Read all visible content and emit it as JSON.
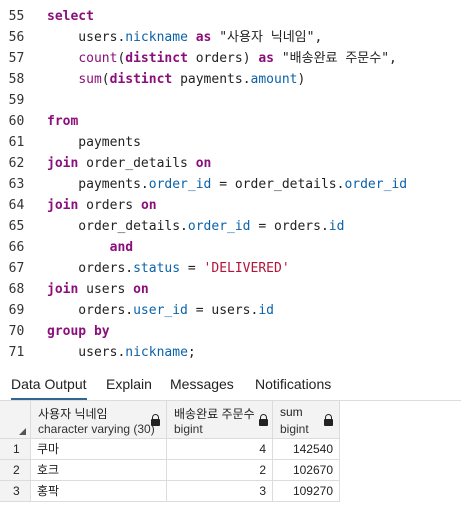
{
  "editor": {
    "lines": [
      {
        "n": "55",
        "tokens": [
          {
            "t": "select",
            "c": "kw"
          }
        ]
      },
      {
        "n": "56",
        "tokens": [
          {
            "t": "    users.",
            "c": "plain"
          },
          {
            "t": "nickname",
            "c": "prop"
          },
          {
            "t": " ",
            "c": "plain"
          },
          {
            "t": "as",
            "c": "kw"
          },
          {
            "t": " \"사용자 닉네임\",",
            "c": "plain"
          }
        ]
      },
      {
        "n": "57",
        "tokens": [
          {
            "t": "    ",
            "c": "plain"
          },
          {
            "t": "count",
            "c": "fn"
          },
          {
            "t": "(",
            "c": "plain"
          },
          {
            "t": "distinct",
            "c": "kw"
          },
          {
            "t": " orders) ",
            "c": "plain"
          },
          {
            "t": "as",
            "c": "kw"
          },
          {
            "t": " \"배송완료 주문수\",",
            "c": "plain"
          }
        ]
      },
      {
        "n": "58",
        "tokens": [
          {
            "t": "    ",
            "c": "plain"
          },
          {
            "t": "sum",
            "c": "fn"
          },
          {
            "t": "(",
            "c": "plain"
          },
          {
            "t": "distinct",
            "c": "kw"
          },
          {
            "t": " payments.",
            "c": "plain"
          },
          {
            "t": "amount",
            "c": "prop"
          },
          {
            "t": ")",
            "c": "plain"
          }
        ]
      },
      {
        "n": "59",
        "tokens": []
      },
      {
        "n": "60",
        "tokens": [
          {
            "t": "from",
            "c": "kw"
          }
        ]
      },
      {
        "n": "61",
        "tokens": [
          {
            "t": "    payments",
            "c": "plain"
          }
        ]
      },
      {
        "n": "62",
        "tokens": [
          {
            "t": "join",
            "c": "kw"
          },
          {
            "t": " order_details ",
            "c": "plain"
          },
          {
            "t": "on",
            "c": "kw"
          }
        ]
      },
      {
        "n": "63",
        "tokens": [
          {
            "t": "    payments.",
            "c": "plain"
          },
          {
            "t": "order_id",
            "c": "prop"
          },
          {
            "t": " = order_details.",
            "c": "plain"
          },
          {
            "t": "order_id",
            "c": "prop"
          }
        ]
      },
      {
        "n": "64",
        "tokens": [
          {
            "t": "join",
            "c": "kw"
          },
          {
            "t": " orders ",
            "c": "plain"
          },
          {
            "t": "on",
            "c": "kw"
          }
        ]
      },
      {
        "n": "65",
        "tokens": [
          {
            "t": "    order_details.",
            "c": "plain"
          },
          {
            "t": "order_id",
            "c": "prop"
          },
          {
            "t": " = orders.",
            "c": "plain"
          },
          {
            "t": "id",
            "c": "prop"
          }
        ]
      },
      {
        "n": "66",
        "tokens": [
          {
            "t": "        ",
            "c": "plain"
          },
          {
            "t": "and",
            "c": "kw"
          }
        ]
      },
      {
        "n": "67",
        "tokens": [
          {
            "t": "    orders.",
            "c": "plain"
          },
          {
            "t": "status",
            "c": "prop"
          },
          {
            "t": " = ",
            "c": "plain"
          },
          {
            "t": "'DELIVERED'",
            "c": "str"
          }
        ]
      },
      {
        "n": "68",
        "tokens": [
          {
            "t": "join",
            "c": "kw"
          },
          {
            "t": " users ",
            "c": "plain"
          },
          {
            "t": "on",
            "c": "kw"
          }
        ]
      },
      {
        "n": "69",
        "tokens": [
          {
            "t": "    orders.",
            "c": "plain"
          },
          {
            "t": "user_id",
            "c": "prop"
          },
          {
            "t": " = users.",
            "c": "plain"
          },
          {
            "t": "id",
            "c": "prop"
          }
        ]
      },
      {
        "n": "70",
        "tokens": [
          {
            "t": "group",
            "c": "kw"
          },
          {
            "t": " ",
            "c": "plain"
          },
          {
            "t": "by",
            "c": "kw"
          }
        ]
      },
      {
        "n": "71",
        "tokens": [
          {
            "t": "    users.",
            "c": "plain"
          },
          {
            "t": "nickname",
            "c": "prop"
          },
          {
            "t": ";",
            "c": "plain"
          }
        ]
      }
    ]
  },
  "tabs": [
    {
      "label": "Data Output",
      "active": true
    },
    {
      "label": "Explain",
      "active": false
    },
    {
      "label": "Messages",
      "active": false
    },
    {
      "label": "Notifications",
      "active": false
    }
  ],
  "grid": {
    "columns": [
      {
        "name": "사용자 닉네임",
        "type": "character varying (30)",
        "locked": true
      },
      {
        "name": "배송완료 주문수",
        "type": "bigint",
        "locked": true
      },
      {
        "name": "sum",
        "type": "bigint",
        "locked": true
      }
    ],
    "rows": [
      {
        "num": "1",
        "cells": [
          "쿠마",
          "4",
          "142540"
        ]
      },
      {
        "num": "2",
        "cells": [
          "호크",
          "2",
          "102670"
        ]
      },
      {
        "num": "3",
        "cells": [
          "홍팍",
          "3",
          "109270"
        ]
      }
    ]
  },
  "icons": {
    "lock": "lock-icon",
    "sort": "sort-corner-icon"
  },
  "colors": {
    "keyword": "#8b0f7a",
    "property": "#0b62a8",
    "string": "#b3153a",
    "active_tab": "#326690"
  }
}
